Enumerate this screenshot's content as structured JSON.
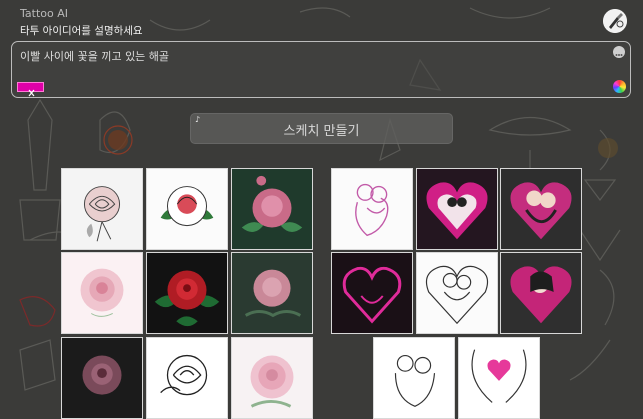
{
  "header": {
    "app_title": "Tattoo AI",
    "subtitle": "타투 아이디어를 설명하세요"
  },
  "prompt": {
    "value": "이빨 사이에 꽃을 끼고 있는 해골"
  },
  "actions": {
    "sketch_label": "스케치 만들기",
    "clear_icon": "close-icon",
    "more_icon": "more-horizontal-icon",
    "color_icon": "color-wheel-icon"
  },
  "gallery": {
    "left": [
      "rose-sketch",
      "rose-white",
      "rose-green",
      "rose-pink-soft",
      "rose-red-dark",
      "rose-green-dark",
      "rose-mauve-dark",
      "rose-outline",
      "rose-pink-bloom"
    ],
    "right": [
      "couple-pink-line",
      "couple-heart-magenta",
      "couple-heart-dark",
      "couple-heart-neon",
      "couple-heart-line",
      "couple-heart-lady",
      "couple-outline-kiss",
      "couple-heart-pink-line"
    ]
  },
  "colors": {
    "accent": "#e000a8",
    "background": "#3b3b39"
  }
}
